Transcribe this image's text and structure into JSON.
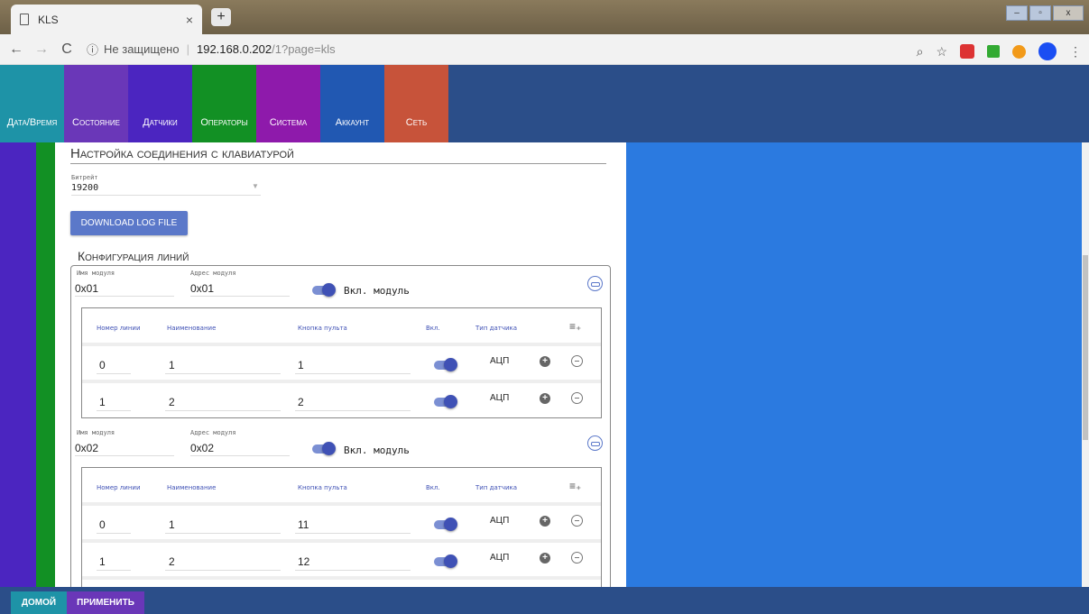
{
  "browser": {
    "tab_title": "KLS",
    "tab_close": "×",
    "new_tab": "+",
    "security": "Не защищено",
    "host": "192.168.0.202",
    "path": "/1?page=kls",
    "zoom_icon": "zoom-icon",
    "star_icon": "star-icon",
    "menu": "⋮"
  },
  "nav": {
    "tiles": [
      {
        "label": "Дата/Время",
        "color": "#1e93a7"
      },
      {
        "label": "Состояние",
        "color": "#6a37b8"
      },
      {
        "label": "Датчики",
        "color": "#4b25c0"
      },
      {
        "label": "Операторы",
        "color": "#129024"
      },
      {
        "label": "Система",
        "color": "#8e1aab"
      },
      {
        "label": "Аккаунт",
        "color": "#2158b2"
      },
      {
        "label": "Сеть",
        "color": "#c7533a"
      }
    ]
  },
  "settings": {
    "title": "Настройка соединения с клавиатурой",
    "baud_label": "Битрейт",
    "baud_value": "19200",
    "download_btn": "DOWNLOAD LOG FILE",
    "lines_title": "Конфигурация линий"
  },
  "modules": [
    {
      "name_label": "Имя модуля",
      "name": "0x01",
      "addr_label": "Адрес модуля",
      "addr": "0x01",
      "enabled_label": "Вкл. модуль",
      "enabled": true,
      "headers": [
        "Номер линии",
        "Наименование",
        "Кнопка пульта",
        "Вкл.",
        "Тип датчика"
      ],
      "rows": [
        {
          "num": "0",
          "name": "1",
          "button": "1",
          "type": "АЦП",
          "on": true
        },
        {
          "num": "1",
          "name": "2",
          "button": "2",
          "type": "АЦП",
          "on": true
        }
      ]
    },
    {
      "name_label": "Имя модуля",
      "name": "0x02",
      "addr_label": "Адрес модуля",
      "addr": "0x02",
      "enabled_label": "Вкл. модуль",
      "enabled": true,
      "headers": [
        "Номер линии",
        "Наименование",
        "Кнопка пульта",
        "Вкл.",
        "Тип датчика"
      ],
      "rows": [
        {
          "num": "0",
          "name": "1",
          "button": "11",
          "type": "АЦП",
          "on": true
        },
        {
          "num": "1",
          "name": "2",
          "button": "12",
          "type": "АЦП",
          "on": true
        }
      ]
    }
  ],
  "footer": {
    "home": "ДОМОЙ",
    "home_color": "#1e93a7",
    "apply": "ПРИМЕНИТЬ",
    "apply_color": "#6a37b8"
  }
}
